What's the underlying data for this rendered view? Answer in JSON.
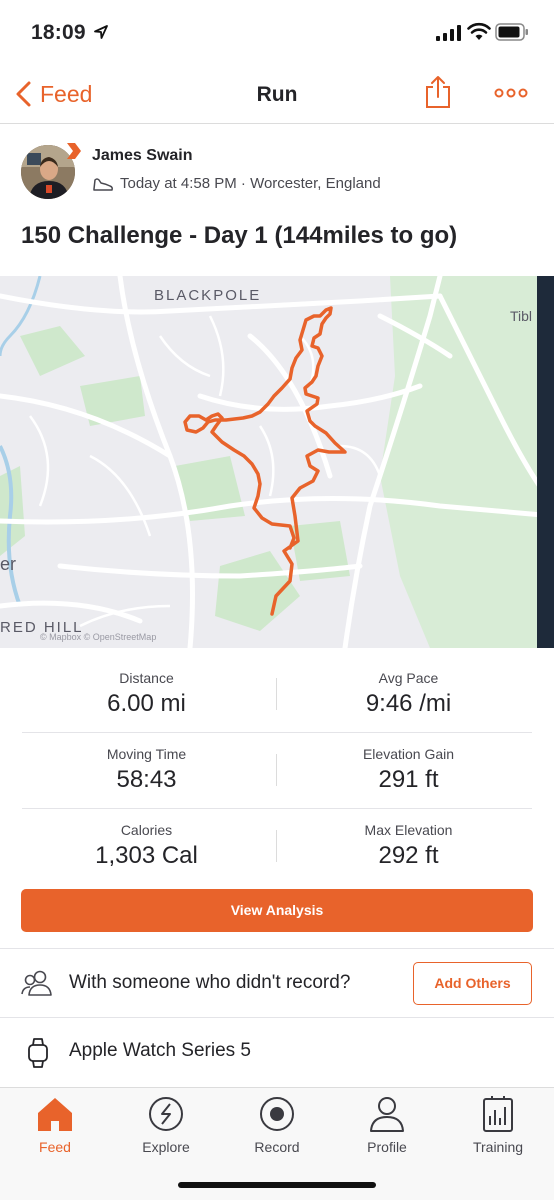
{
  "status_bar": {
    "time": "18:09"
  },
  "nav": {
    "back_label": "Feed",
    "title": "Run"
  },
  "athlete": {
    "name": "James Swain",
    "meta": "Today at 4:58 PM · Worcester, England"
  },
  "activity": {
    "title": "150 Challenge - Day 1 (144miles to go)"
  },
  "map": {
    "labels": {
      "north": "BLACKPOLE",
      "south": "RED HILL",
      "east": "Tibl",
      "west": "er"
    },
    "attribution": "© Mapbox © OpenStreetMap"
  },
  "stats": {
    "distance": {
      "label": "Distance",
      "value": "6.00 mi"
    },
    "avg_pace": {
      "label": "Avg Pace",
      "value": "9:46 /mi"
    },
    "moving_time": {
      "label": "Moving Time",
      "value": "58:43"
    },
    "elevation_gain": {
      "label": "Elevation Gain",
      "value": "291 ft"
    },
    "calories": {
      "label": "Calories",
      "value": "1,303 Cal"
    },
    "max_elevation": {
      "label": "Max Elevation",
      "value": "292 ft"
    }
  },
  "actions": {
    "view_analysis": "View Analysis",
    "with_someone": "With someone who didn't record?",
    "add_others": "Add Others",
    "device": "Apple Watch Series 5"
  },
  "tabs": [
    {
      "label": "Feed",
      "icon": "home-icon",
      "active": true
    },
    {
      "label": "Explore",
      "icon": "compass-icon",
      "active": false
    },
    {
      "label": "Record",
      "icon": "record-icon",
      "active": false
    },
    {
      "label": "Profile",
      "icon": "profile-icon",
      "active": false
    },
    {
      "label": "Training",
      "icon": "training-icon",
      "active": false
    }
  ],
  "colors": {
    "accent": "#e8632b",
    "text": "#242428",
    "map_bg": "#ececf0",
    "route": "#e8632b"
  }
}
